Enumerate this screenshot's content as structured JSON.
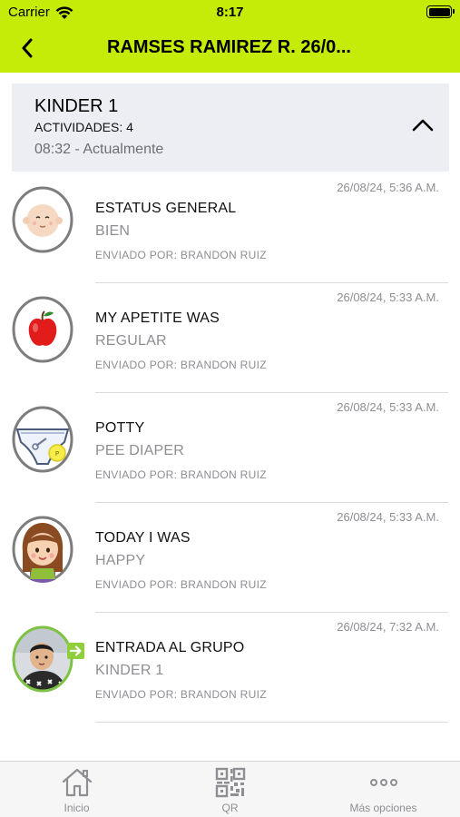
{
  "status_bar": {
    "carrier": "Carrier",
    "time": "8:17"
  },
  "nav": {
    "title": "RAMSES RAMIREZ R. 26/0...",
    "back_icon": "chevron-left-icon"
  },
  "group": {
    "name": "KINDER 1",
    "activities_count": "ACTIVIDADES: 4",
    "time_range": "08:32 - Actualmente",
    "collapse_icon": "chevron-up-icon"
  },
  "activities": [
    {
      "date": "26/08/24, 5:36 A.M.",
      "title": "ESTATUS GENERAL",
      "value": "BIEN",
      "sender": "ENVIADO POR: BRANDON RUIZ",
      "icon": "baby-face-icon"
    },
    {
      "date": "26/08/24, 5:33 A.M.",
      "title": "MY APETITE WAS",
      "value": "REGULAR",
      "sender": "ENVIADO POR: BRANDON RUIZ",
      "icon": "apple-icon"
    },
    {
      "date": "26/08/24, 5:33 A.M.",
      "title": "POTTY",
      "value": "PEE DIAPER",
      "sender": "ENVIADO POR: BRANDON RUIZ",
      "icon": "diaper-icon"
    },
    {
      "date": "26/08/24, 5:33 A.M.",
      "title": "TODAY I WAS",
      "value": "HAPPY",
      "sender": "ENVIADO POR: BRANDON RUIZ",
      "icon": "happy-girl-icon"
    },
    {
      "date": "26/08/24, 7:32 A.M.",
      "title": "ENTRADA AL GRUPO",
      "value": "KINDER 1",
      "sender": "ENVIADO POR: BRANDON RUIZ",
      "icon": "child-photo-avatar"
    }
  ],
  "tabbar": {
    "tabs": [
      {
        "label": "Inicio",
        "icon": "home-icon"
      },
      {
        "label": "QR",
        "icon": "qr-code-icon"
      },
      {
        "label": "Más opciones",
        "icon": "more-options-icon"
      }
    ]
  },
  "colors": {
    "accent": "#c5eb09",
    "card": "#eceef3",
    "muted": "#8e8e93"
  }
}
